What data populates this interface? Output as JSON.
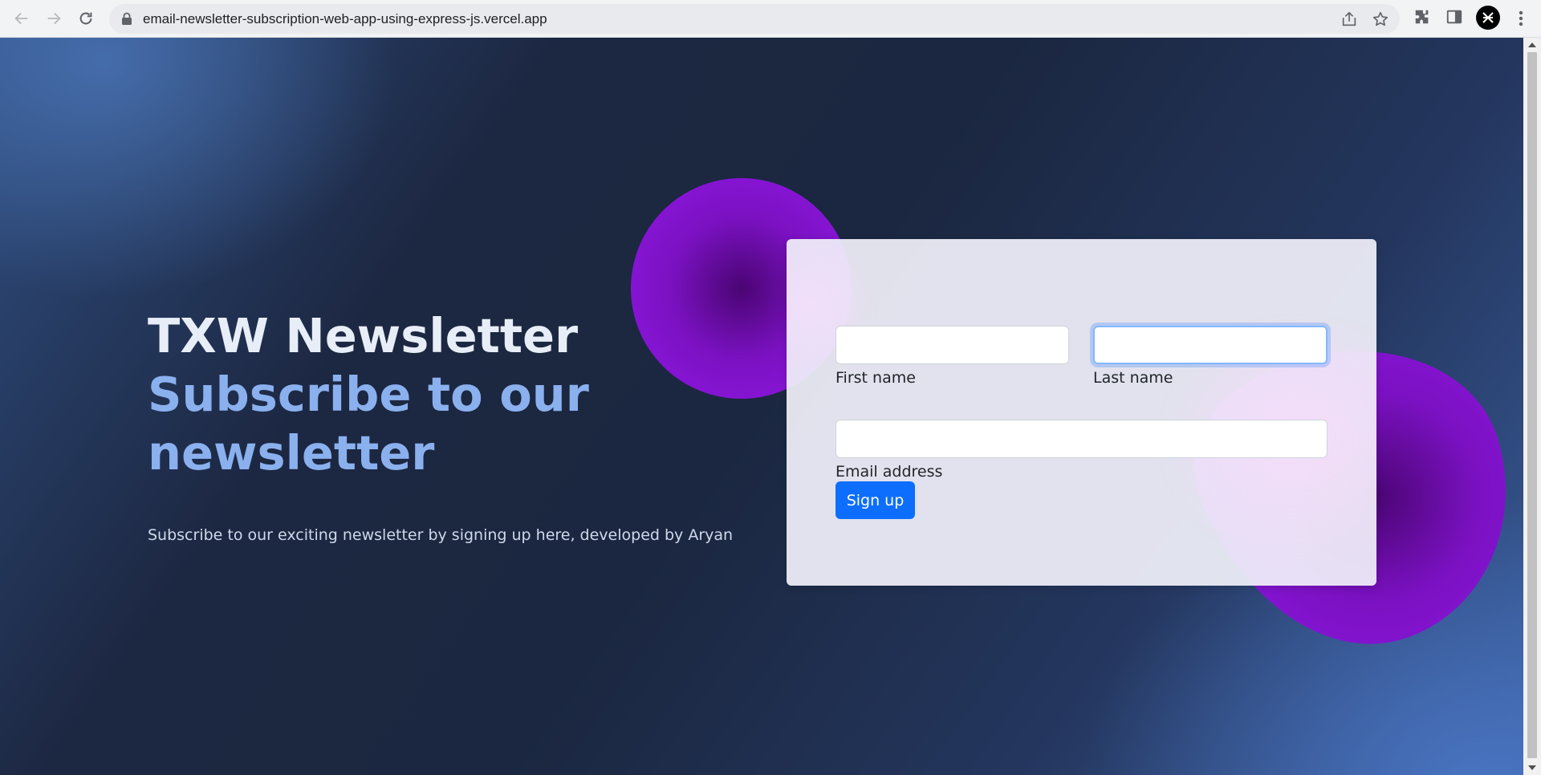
{
  "browser": {
    "url": "email-newsletter-subscription-web-app-using-express-js.vercel.app",
    "icons": [
      "back-arrow-icon",
      "forward-arrow-icon",
      "reload-icon",
      "lock-icon",
      "share-icon",
      "star-icon",
      "extensions-icon",
      "side-panel-icon",
      "profile-avatar",
      "more-menu-icon"
    ]
  },
  "hero": {
    "title": "TXW Newsletter",
    "subtitle": "Subscribe to our newsletter",
    "description": "Subscribe to our exciting newsletter by signing up here, developed by Aryan"
  },
  "form": {
    "first_name": {
      "label": "First name",
      "value": "",
      "placeholder": ""
    },
    "last_name": {
      "label": "Last name",
      "value": "",
      "placeholder": ""
    },
    "email": {
      "label": "Email address",
      "value": "",
      "placeholder": ""
    },
    "submit_label": "Sign up"
  },
  "colors": {
    "title": "#e8eef8",
    "subtitle": "#8ab0ee",
    "button": "#0d6efd",
    "blob": "#7a11c1"
  }
}
